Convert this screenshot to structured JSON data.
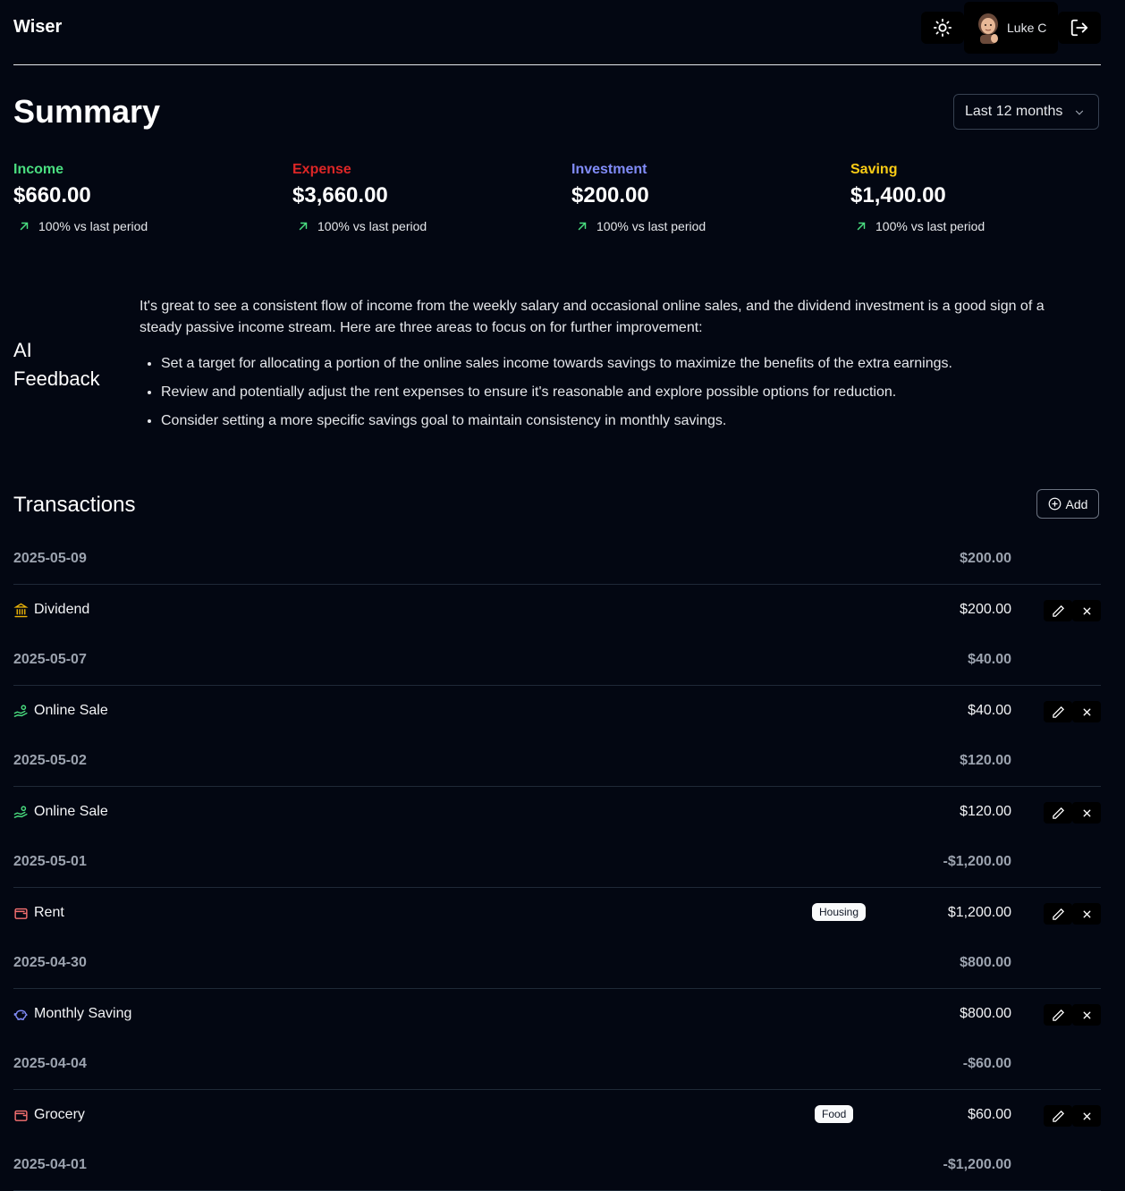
{
  "header": {
    "brand": "Wiser",
    "user_name": "Luke C"
  },
  "summary": {
    "title": "Summary",
    "period": "Last 12 months",
    "stats": [
      {
        "label": "Income",
        "value": "$660.00",
        "delta": "100% vs last period",
        "color": "#4ade80"
      },
      {
        "label": "Expense",
        "value": "$3,660.00",
        "delta": "100% vs last period",
        "color": "#dc2626"
      },
      {
        "label": "Investment",
        "value": "$200.00",
        "delta": "100% vs last period",
        "color": "#818cf8"
      },
      {
        "label": "Saving",
        "value": "$1,400.00",
        "delta": "100% vs last period",
        "color": "#facc15"
      }
    ]
  },
  "ai_feedback": {
    "title_line1": "AI",
    "title_line2": "Feedback",
    "intro": "It's great to see a consistent flow of income from the weekly salary and occasional online sales, and the dividend investment is a good sign of a steady passive income stream. Here are three areas to focus on for further improvement:",
    "points": [
      "Set a target for allocating a portion of the online sales income towards savings to maximize the benefits of the extra earnings.",
      "Review and potentially adjust the rent expenses to ensure it's reasonable and explore possible options for reduction.",
      "Consider setting a more specific savings goal to maintain consistency in monthly savings."
    ]
  },
  "transactions": {
    "title": "Transactions",
    "add_label": "Add",
    "groups": [
      {
        "date": "2025-05-09",
        "total": "$200.00",
        "items": [
          {
            "name": "Dividend",
            "amount": "$200.00",
            "icon": "bank-icon",
            "tag": ""
          }
        ]
      },
      {
        "date": "2025-05-07",
        "total": "$40.00",
        "items": [
          {
            "name": "Online Sale",
            "amount": "$40.00",
            "icon": "hand-coins-icon",
            "tag": ""
          }
        ]
      },
      {
        "date": "2025-05-02",
        "total": "$120.00",
        "items": [
          {
            "name": "Online Sale",
            "amount": "$120.00",
            "icon": "hand-coins-icon",
            "tag": ""
          }
        ]
      },
      {
        "date": "2025-05-01",
        "total": "-$1,200.00",
        "items": [
          {
            "name": "Rent",
            "amount": "$1,200.00",
            "icon": "wallet-icon",
            "tag": "Housing"
          }
        ]
      },
      {
        "date": "2025-04-30",
        "total": "$800.00",
        "items": [
          {
            "name": "Monthly Saving",
            "amount": "$800.00",
            "icon": "piggy-bank-icon",
            "tag": ""
          }
        ]
      },
      {
        "date": "2025-04-04",
        "total": "-$60.00",
        "items": [
          {
            "name": "Grocery",
            "amount": "$60.00",
            "icon": "wallet-icon",
            "tag": "Food"
          }
        ]
      },
      {
        "date": "2025-04-01",
        "total": "-$1,200.00",
        "items": []
      }
    ]
  }
}
